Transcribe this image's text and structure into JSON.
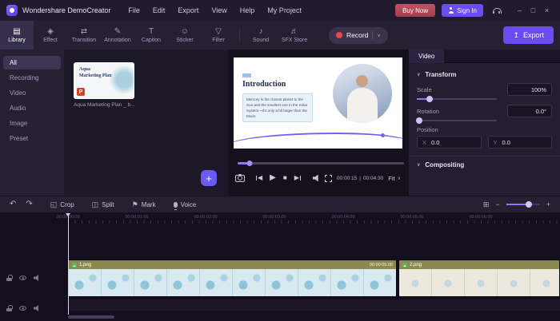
{
  "colors": {
    "accent": "#6a4cf0",
    "buy_now": "#b2454f",
    "record_dot": "#e5484d",
    "clip_header": "#8c894f"
  },
  "icons": {
    "minimize": "–",
    "maximize": "□",
    "close": "×",
    "chevron_down": "∨",
    "undo": "↶",
    "redo": "↷",
    "crop": "◱",
    "split": "◫",
    "mark": "⚑",
    "play": "▶",
    "stop": "■",
    "prev": "◀",
    "next": "▶",
    "export": "↥",
    "zoom_out": "−",
    "zoom_in": "+",
    "zoom_fit": "⊞",
    "add": "+"
  },
  "titlebar": {
    "app_title": "Wondershare DemoCreator",
    "menus": [
      "File",
      "Edit",
      "Export",
      "View",
      "Help",
      "My Project"
    ],
    "buy_now_label": "Buy Now",
    "sign_in_label": "Sign In"
  },
  "ribbon": {
    "tabs": [
      {
        "label": "Library",
        "icon": "▤"
      },
      {
        "label": "Effect",
        "icon": "◈"
      },
      {
        "label": "Transition",
        "icon": "⇄"
      },
      {
        "label": "Annotation",
        "icon": "✎"
      },
      {
        "label": "Caption",
        "icon": "T"
      },
      {
        "label": "Sticker",
        "icon": "☺"
      },
      {
        "label": "Filter",
        "icon": "▽"
      },
      {
        "label": "Sound",
        "icon": "♪"
      },
      {
        "label": "SFX Store",
        "icon": "♬"
      }
    ],
    "record_label": "Record",
    "export_label": "Export"
  },
  "library": {
    "categories": [
      "All",
      "Recording",
      "Video",
      "Audio",
      "Image",
      "Preset"
    ],
    "item": {
      "badge": "P",
      "thumb_title": "Aqua Marketing Plan",
      "name": "Aqua Marketing Plan _ b..."
    }
  },
  "preview": {
    "slide": {
      "title": "Introduction",
      "body": "Mercury is the closest planet to the Sun and the smallest one in the Solar System—it's only a bit larger than the Moon"
    },
    "current_time": "00:00:15",
    "time_separator": "|",
    "duration": "00:04:30",
    "fit_label": "Fit"
  },
  "inspector": {
    "tab_label": "Video",
    "transform": {
      "title": "Transform",
      "scale_label": "Scale",
      "scale_value": "100%",
      "rotation_label": "Rotation",
      "rotation_value": "0.0°",
      "position_label": "Position",
      "x_label": "X",
      "x_value": "0.0",
      "y_label": "Y",
      "y_value": "0.0"
    },
    "compositing_title": "Compositing"
  },
  "edit_toolbar": {
    "crop_label": "Crop",
    "split_label": "Split",
    "mark_label": "Mark",
    "voice_label": "Voice"
  },
  "timeline": {
    "ruler": [
      "00:00:00.00",
      "00:00:01.00",
      "00:00:02.00",
      "00:00:03.00",
      "00:00:04.00",
      "00:00:05.00",
      "00:00:06.00"
    ],
    "clips": [
      {
        "name": "1.png",
        "duration": "00:00:05.00"
      },
      {
        "name": "2.png"
      }
    ]
  }
}
